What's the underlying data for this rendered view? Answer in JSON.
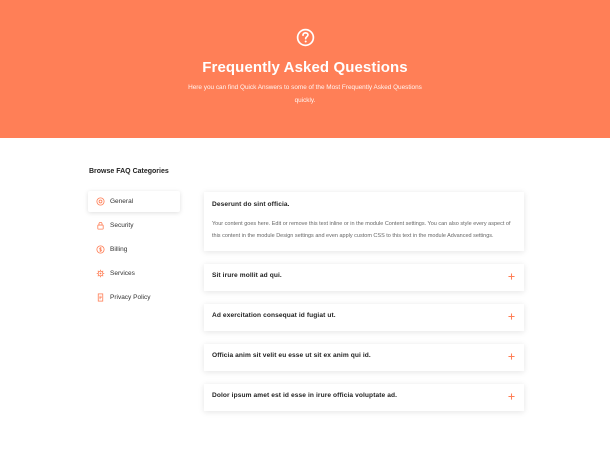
{
  "hero": {
    "icon": "question-circle-icon",
    "title": "Frequently Asked Questions",
    "subtitle": "Here you can find Quick Answers to some of the Most Frequently Asked Questions quickly.",
    "background": "#ff7f57"
  },
  "sidebar": {
    "heading": "Browse FAQ Categories",
    "accent": "#ff7f57",
    "items": [
      {
        "label": "General",
        "icon": "gear-icon",
        "active": true
      },
      {
        "label": "Security",
        "icon": "lock-icon",
        "active": false
      },
      {
        "label": "Billing",
        "icon": "dollar-icon",
        "active": false
      },
      {
        "label": "Services",
        "icon": "cog-icon",
        "active": false
      },
      {
        "label": "Privacy Policy",
        "icon": "document-icon",
        "active": false
      }
    ]
  },
  "faqs": [
    {
      "question": "Deserunt do sint officia.",
      "answer": "Your content goes here. Edit or remove this text inline or in the module Content settings. You can also style every aspect of this content in the module Design settings and even apply custom CSS to this text in the module Advanced settings.",
      "open": true
    },
    {
      "question": "Sit irure mollit ad qui.",
      "open": false
    },
    {
      "question": "Ad exercitation consequat id fugiat ut.",
      "open": false
    },
    {
      "question": "Officia anim sit velit eu esse ut sit ex anim qui id.",
      "open": false
    },
    {
      "question": "Dolor ipsum amet est id esse in irure officia voluptate ad.",
      "open": false
    }
  ]
}
